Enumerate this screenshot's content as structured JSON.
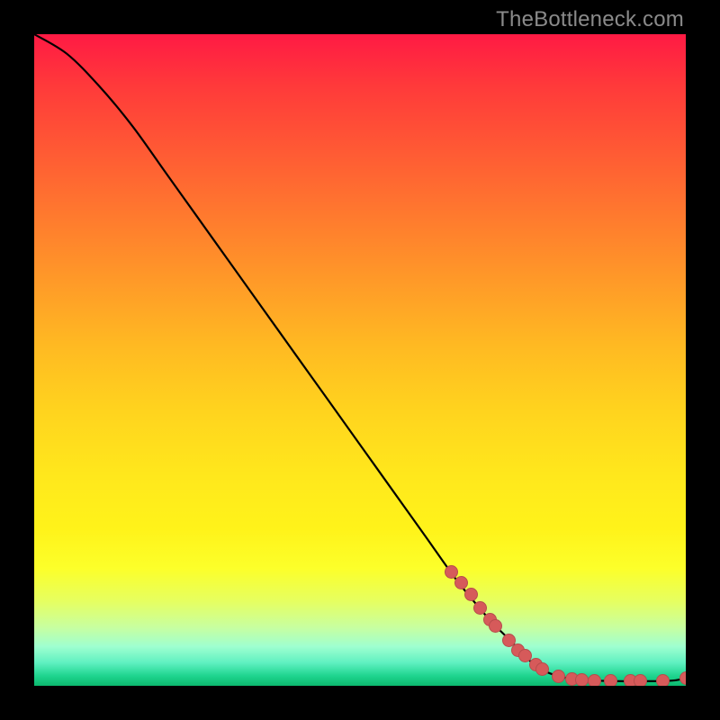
{
  "watermark": "TheBottleneck.com",
  "colors": {
    "frame": "#000000",
    "curve": "#000000",
    "marker": "#d65a5a"
  },
  "chart_data": {
    "type": "line",
    "title": "",
    "xlabel": "",
    "ylabel": "",
    "xlim": [
      0,
      100
    ],
    "ylim": [
      0,
      100
    ],
    "grid": false,
    "curve": {
      "x": [
        0,
        5,
        10,
        15,
        20,
        25,
        30,
        35,
        40,
        45,
        50,
        55,
        60,
        65,
        70,
        72,
        75,
        77,
        80,
        83,
        86,
        90,
        94,
        98,
        100
      ],
      "y": [
        100,
        97,
        92,
        86,
        79,
        72,
        65,
        58,
        51,
        44,
        37,
        30,
        23,
        16,
        10,
        8,
        5,
        3,
        1.6,
        1.0,
        0.8,
        0.7,
        0.7,
        0.8,
        1.2
      ]
    },
    "markers": [
      {
        "x": 64.0,
        "y": 17.5
      },
      {
        "x": 65.5,
        "y": 15.8
      },
      {
        "x": 67.0,
        "y": 14.0
      },
      {
        "x": 68.5,
        "y": 12.0
      },
      {
        "x": 70.0,
        "y": 10.2
      },
      {
        "x": 70.8,
        "y": 9.2
      },
      {
        "x": 72.8,
        "y": 7.0
      },
      {
        "x": 74.2,
        "y": 5.5
      },
      {
        "x": 75.3,
        "y": 4.6
      },
      {
        "x": 77.0,
        "y": 3.3
      },
      {
        "x": 78.0,
        "y": 2.6
      },
      {
        "x": 80.5,
        "y": 1.4
      },
      {
        "x": 82.5,
        "y": 1.0
      },
      {
        "x": 84.0,
        "y": 0.9
      },
      {
        "x": 86.0,
        "y": 0.8
      },
      {
        "x": 88.5,
        "y": 0.75
      },
      {
        "x": 91.5,
        "y": 0.7
      },
      {
        "x": 93.0,
        "y": 0.7
      },
      {
        "x": 96.5,
        "y": 0.8
      },
      {
        "x": 100.0,
        "y": 1.2
      }
    ]
  }
}
